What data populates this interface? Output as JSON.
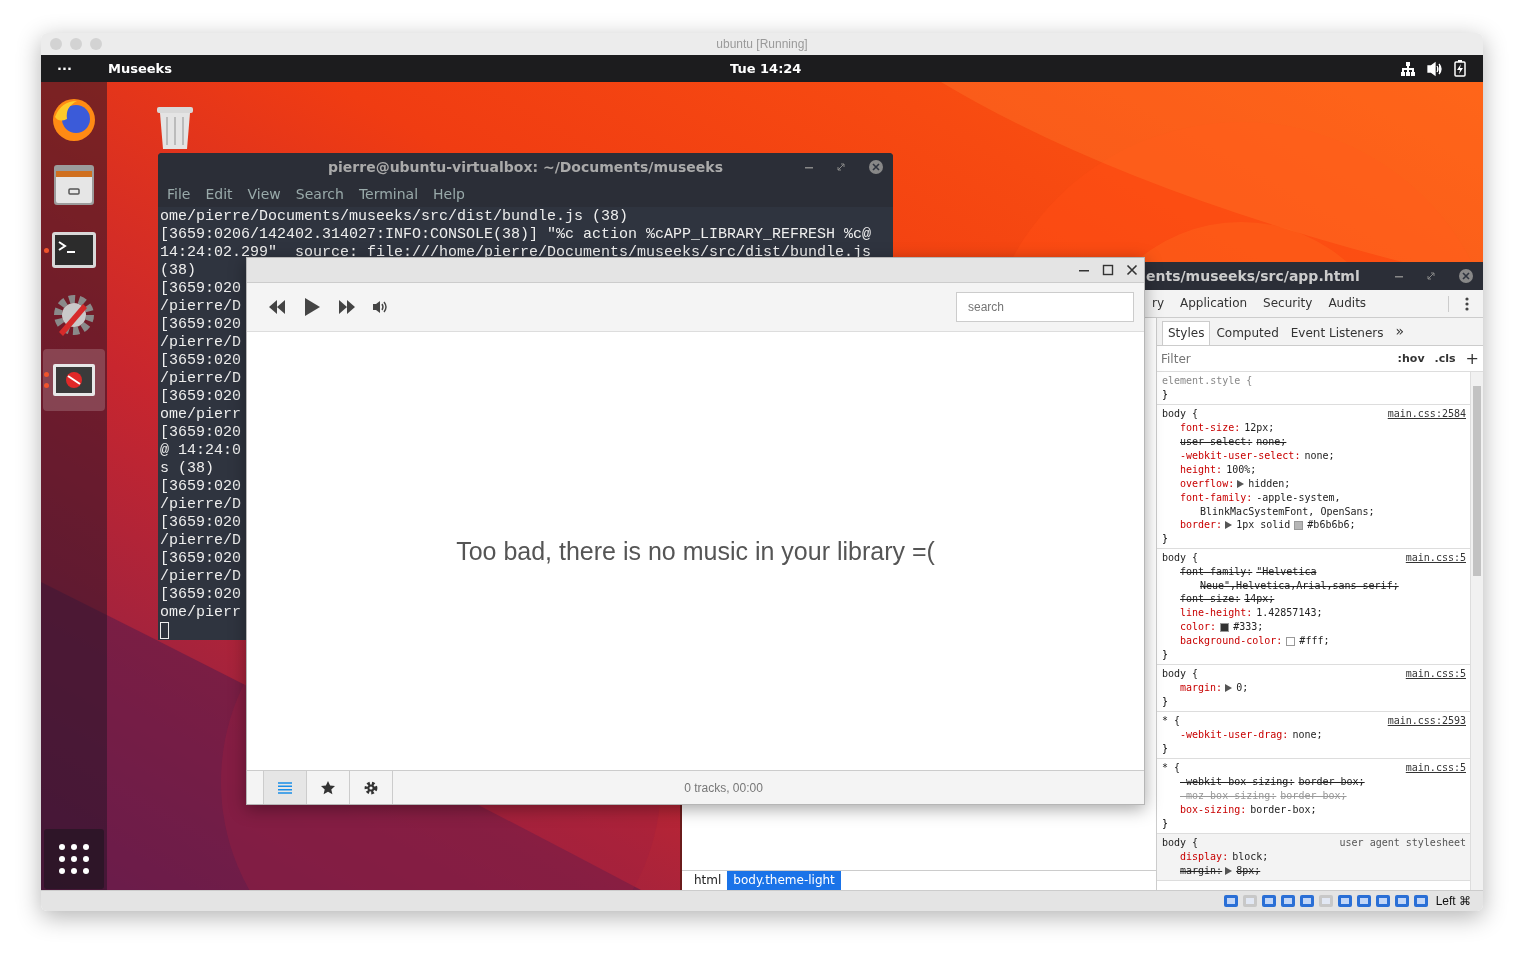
{
  "host_window": {
    "title": "ubuntu [Running]"
  },
  "top_bar": {
    "activities": "···",
    "app_name": "Museeks",
    "clock": "Tue 14:24"
  },
  "dock": {
    "items": [
      {
        "kind": "browser",
        "running": false,
        "multi_window": false,
        "selected": false
      },
      {
        "kind": "files",
        "running": false,
        "multi_window": false,
        "selected": false
      },
      {
        "kind": "terminal",
        "running": true,
        "multi_window": false,
        "selected": false
      },
      {
        "kind": "settings",
        "running": false,
        "multi_window": false,
        "selected": false
      },
      {
        "kind": "app",
        "running": true,
        "multi_window": true,
        "selected": true
      }
    ]
  },
  "terminal": {
    "title": "pierre@ubuntu-virtualbox: ~/Documents/museeks",
    "menu": [
      "File",
      "Edit",
      "View",
      "Search",
      "Terminal",
      "Help"
    ],
    "lines": [
      "ome/pierre/Documents/museeks/src/dist/bundle.js (38)",
      "[3659:0206/142402.314027:INFO:CONSOLE(38)] \"%c action %cAPP_LIBRARY_REFRESH %c@",
      "14:24:02.299\"  source: file:///home/pierre/Documents/museeks/src/dist/bundle.js",
      "(38)",
      "[3659:020",
      "/pierre/D",
      "[3659:020",
      "/pierre/D",
      "[3659:020",
      "/pierre/D",
      "[3659:020",
      "ome/pierr",
      "[3659:020",
      "@ 14:24:0",
      "s (38)",
      "[3659:020",
      "/pierre/D",
      "[3659:020",
      "/pierre/D",
      "[3659:020",
      "/pierre/D",
      "[3659:020",
      "ome/pierr"
    ]
  },
  "devtools": {
    "title": "ents/museeks/src/app.html",
    "tabs": [
      {
        "label": "ry",
        "selected": false
      },
      {
        "label": "Application",
        "selected": false
      },
      {
        "label": "Security",
        "selected": false
      },
      {
        "label": "Audits",
        "selected": false
      }
    ],
    "subtabs": [
      {
        "label": "Styles",
        "selected": true
      },
      {
        "label": "Computed",
        "selected": false
      },
      {
        "label": "Event Listeners",
        "selected": false
      }
    ],
    "more": "»",
    "filter": {
      "placeholder": "Filter"
    },
    "hov": ":hov",
    "cls": ".cls",
    "add": "+",
    "rules": [
      {
        "selector": "element.style {",
        "close": "}",
        "inline": true,
        "user_agent": false
      },
      {
        "selector": "body {",
        "source": "main.css:2584",
        "close": "}",
        "inline": false,
        "user_agent": false,
        "declarations": [
          {
            "property": "font-size:",
            "value": "12px;",
            "struck": false,
            "invalid": false,
            "expander": false
          },
          {
            "property": "user-select:",
            "value": "none;",
            "struck": true,
            "invalid": false,
            "expander": false
          },
          {
            "property": "-webkit-user-select:",
            "value": "none;",
            "struck": false,
            "invalid": false,
            "expander": false
          },
          {
            "property": "height:",
            "value": "100%;",
            "struck": false,
            "invalid": false,
            "expander": false
          },
          {
            "property": "overflow:",
            "value": "hidden;",
            "struck": false,
            "invalid": false,
            "expander": true
          },
          {
            "property": "font-family:",
            "value": "-apple-system,",
            "continuation": "BlinkMacSystemFont, OpenSans;",
            "struck": false,
            "invalid": false,
            "expander": false
          },
          {
            "property": "border:",
            "value": "1px solid",
            "color": "#b6b6b6",
            "after": "#b6b6b6;",
            "struck": false,
            "invalid": false,
            "expander": true
          }
        ]
      },
      {
        "selector": "body {",
        "source": "main.css:5",
        "close": "}",
        "inline": false,
        "user_agent": false,
        "declarations": [
          {
            "property": "font-family:",
            "value": "\"Helvetica",
            "continuation": "Neue\",Helvetica,Arial,sans-serif;",
            "struck": true,
            "invalid": false,
            "expander": false
          },
          {
            "property": "font-size:",
            "value": "14px;",
            "struck": true,
            "invalid": false,
            "expander": false
          },
          {
            "property": "line-height:",
            "value": "1.42857143;",
            "struck": false,
            "invalid": false,
            "expander": false
          },
          {
            "property": "color:",
            "color": "#333333",
            "after": "#333;",
            "struck": false,
            "invalid": false,
            "expander": false
          },
          {
            "property": "background-color:",
            "color": "#ffffff",
            "after": "#fff;",
            "struck": false,
            "invalid": false,
            "expander": false
          }
        ]
      },
      {
        "selector": "body {",
        "source": "main.css:5",
        "close": "}",
        "inline": false,
        "user_agent": false,
        "declarations": [
          {
            "property": "margin:",
            "value": "0;",
            "struck": false,
            "invalid": false,
            "expander": true
          }
        ]
      },
      {
        "selector": "* {",
        "source": "main.css:2593",
        "close": "}",
        "inline": false,
        "user_agent": false,
        "declarations": [
          {
            "property": "-webkit-user-drag:",
            "value": "none;",
            "struck": false,
            "invalid": false,
            "expander": false
          }
        ]
      },
      {
        "selector": "* {",
        "source": "main.css:5",
        "close": "}",
        "inline": false,
        "user_agent": false,
        "declarations": [
          {
            "property": "-webkit-box-sizing:",
            "value": "border-box;",
            "struck": true,
            "invalid": false,
            "expander": false
          },
          {
            "property": "-moz-box-sizing:",
            "value": "border-box;",
            "struck": true,
            "invalid": true,
            "expander": false
          },
          {
            "property": "box-sizing:",
            "value": "border-box;",
            "struck": false,
            "invalid": false,
            "expander": false
          }
        ]
      },
      {
        "selector": "body {",
        "source": "user agent stylesheet",
        "inline": false,
        "user_agent": true,
        "declarations": [
          {
            "property": "display:",
            "value": "block;",
            "struck": false,
            "invalid": false,
            "expander": false
          },
          {
            "property": "margin:",
            "value": "8px;",
            "struck": true,
            "invalid": false,
            "expander": true
          }
        ]
      }
    ],
    "breadcrumbs": [
      {
        "label": "html",
        "selected": false
      },
      {
        "label": "body.theme-light",
        "selected": true
      }
    ]
  },
  "museeks": {
    "search": {
      "placeholder": "search"
    },
    "empty_message": "Too bad, there is no music in your library =(",
    "nav": [
      {
        "kind": "library",
        "selected": true
      },
      {
        "kind": "favorites",
        "selected": false
      },
      {
        "kind": "settings",
        "selected": false
      }
    ],
    "status": "0 tracks, 00:00"
  },
  "vbox_status": {
    "host_key": "Left ⌘"
  }
}
